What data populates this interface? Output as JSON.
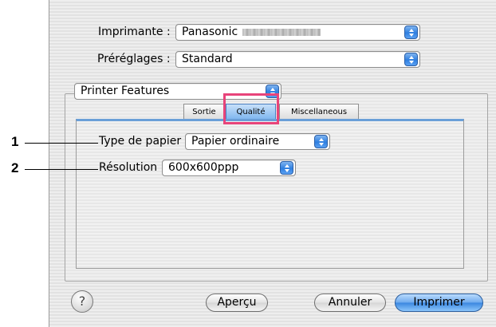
{
  "printer": {
    "label": "Imprimante :",
    "value": "Panasonic"
  },
  "presets": {
    "label": "Préréglages :",
    "value": "Standard"
  },
  "panel_select": {
    "value": "Printer Features"
  },
  "tabs": [
    {
      "label": "Sortie"
    },
    {
      "label": "Qualité"
    },
    {
      "label": "Miscellaneous"
    }
  ],
  "options": [
    {
      "label": "Type de papier",
      "value": "Papier ordinaire"
    },
    {
      "label": "Résolution",
      "value": "600x600ppp"
    }
  ],
  "callouts": [
    "1",
    "2"
  ],
  "buttons": {
    "help": "?",
    "preview": "Aperçu",
    "cancel": "Annuler",
    "print": "Imprimer"
  },
  "colors": {
    "highlight": "#e8447a",
    "accent": "#3a86e0"
  }
}
